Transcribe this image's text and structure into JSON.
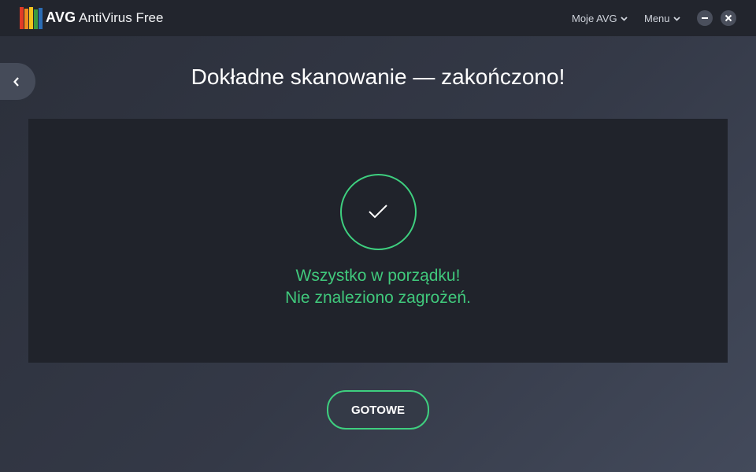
{
  "titlebar": {
    "brand": "AVG",
    "product": "AntiVirus Free",
    "my_avg_label": "Moje AVG",
    "menu_label": "Menu",
    "logo_colors": [
      "#e23b26",
      "#f08b20",
      "#f5c31d",
      "#3a9a3f",
      "#2b6db5"
    ]
  },
  "main": {
    "heading": "Dokładne skanowanie — zakończono!",
    "status_line1": "Wszystko w porządku!",
    "status_line2": "Nie znaleziono zagrożeń.",
    "done_label": "GOTOWE"
  },
  "icons": {
    "back": "chevron-left-icon",
    "minimize": "minimize-icon",
    "close": "close-icon",
    "check": "check-icon"
  },
  "colors": {
    "accent_green": "#3ecf7f",
    "titlebar": "#22252d",
    "panel": "#20232b"
  }
}
